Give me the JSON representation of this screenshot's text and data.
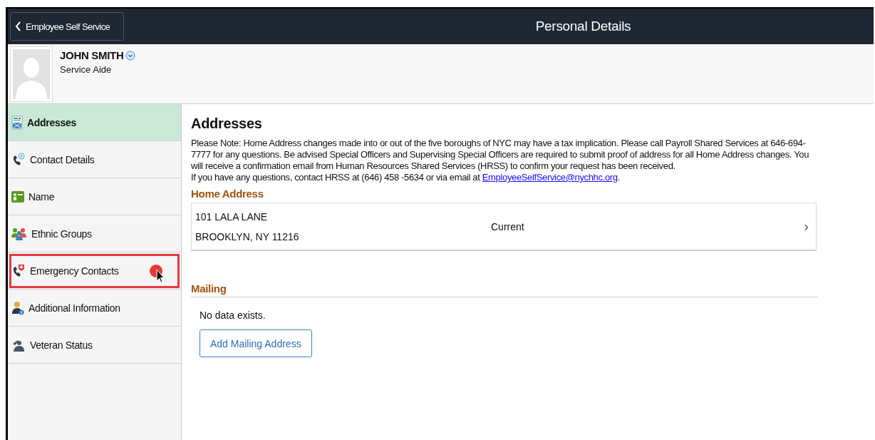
{
  "header": {
    "back_label": "Employee Self Service",
    "title": "Personal Details"
  },
  "profile": {
    "name": "JOHN SMITH",
    "job_title": "Service Aide"
  },
  "sidebar": {
    "items": [
      {
        "label": "Addresses",
        "kind": "addresses",
        "selected": true,
        "highlighted": false
      },
      {
        "label": "Contact Details",
        "kind": "contact",
        "selected": false,
        "highlighted": false
      },
      {
        "label": "Name",
        "kind": "name",
        "selected": false,
        "highlighted": false
      },
      {
        "label": "Ethnic Groups",
        "kind": "groups",
        "selected": false,
        "highlighted": false
      },
      {
        "label": "Emergency Contacts",
        "kind": "emergency",
        "selected": false,
        "highlighted": true
      },
      {
        "label": "Additional Information",
        "kind": "info",
        "selected": false,
        "highlighted": false
      },
      {
        "label": "Veteran Status",
        "kind": "veteran",
        "selected": false,
        "highlighted": false
      }
    ]
  },
  "content": {
    "title": "Addresses",
    "note": "Please Note: Home Address changes made into or out of the five boroughs of NYC may have a tax implication. Please call Payroll Shared Services at 646-694-7777 for any questions. Be advised Special Officers and Supervising Special Officers are required to submit proof of address for all Home Address changes. You will receive a confirmation email from Human Resources Shared Services (HRSS) to confirm your request has been received.",
    "contact_prefix": "If you have any questions, contact HRSS at (646) 458 -5634 or via email at",
    "email": "EmployeeSelfService@nychhc.org",
    "contact_suffix": ".",
    "home": {
      "heading": "Home Address",
      "line1": "101 LALA LANE",
      "line2": "BROOKLYN, NY 11216",
      "status": "Current",
      "chevron": "›"
    },
    "mailing": {
      "heading": "Mailing",
      "empty": "No data exists.",
      "button": "Add Mailing Address"
    }
  }
}
